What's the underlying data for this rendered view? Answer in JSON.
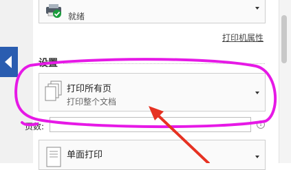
{
  "printer": {
    "status": "就绪",
    "properties_link": "打印机属性"
  },
  "settings": {
    "section_title": "设置",
    "page_range": {
      "title": "打印所有页",
      "subtitle": "打印整个文档"
    },
    "pages_label": "页数:",
    "pages_value": "",
    "duplex": {
      "title": "单面打印"
    }
  },
  "annotation": {
    "ellipse_color": "#e619e6",
    "arrow_color": "#e63222"
  }
}
